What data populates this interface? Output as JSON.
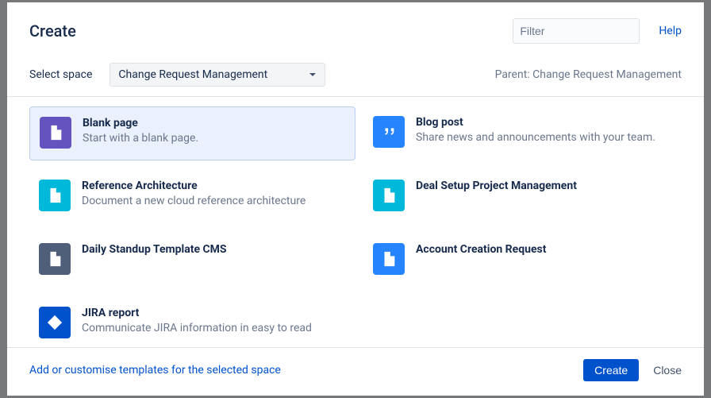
{
  "header": {
    "title": "Create",
    "filter_placeholder": "Filter",
    "help_label": "Help"
  },
  "space": {
    "select_label": "Select space",
    "selected_value": "Change Request Management",
    "parent_label": "Parent: Change Request Management"
  },
  "templates": [
    {
      "title": "Blank page",
      "desc": "Start with a blank page.",
      "icon_color": "icon-purple",
      "icon_kind": "page",
      "selected": true,
      "name": "tpl-blank-page"
    },
    {
      "title": "Blog post",
      "desc": "Share news and announcements with your team.",
      "icon_color": "icon-blue",
      "icon_kind": "quote",
      "selected": false,
      "name": "tpl-blog-post"
    },
    {
      "title": "Reference Architecture",
      "desc": "Document a new cloud reference architecture",
      "icon_color": "icon-teal",
      "icon_kind": "doc",
      "selected": false,
      "name": "tpl-reference-architecture"
    },
    {
      "title": "Deal Setup Project Management",
      "desc": "",
      "icon_color": "icon-teal",
      "icon_kind": "doc",
      "selected": false,
      "name": "tpl-deal-setup"
    },
    {
      "title": "Daily Standup Template CMS",
      "desc": "",
      "icon_color": "icon-gray",
      "icon_kind": "doc",
      "selected": false,
      "name": "tpl-daily-standup"
    },
    {
      "title": "Account Creation Request",
      "desc": "",
      "icon_color": "icon-blue",
      "icon_kind": "doc",
      "selected": false,
      "name": "tpl-account-creation"
    },
    {
      "title": "JIRA report",
      "desc": "Communicate JIRA information in easy to read",
      "icon_color": "icon-darkblue",
      "icon_kind": "jira",
      "selected": false,
      "name": "tpl-jira-report"
    }
  ],
  "footer": {
    "customise_label": "Add or customise templates for the selected space",
    "create_label": "Create",
    "close_label": "Close"
  }
}
